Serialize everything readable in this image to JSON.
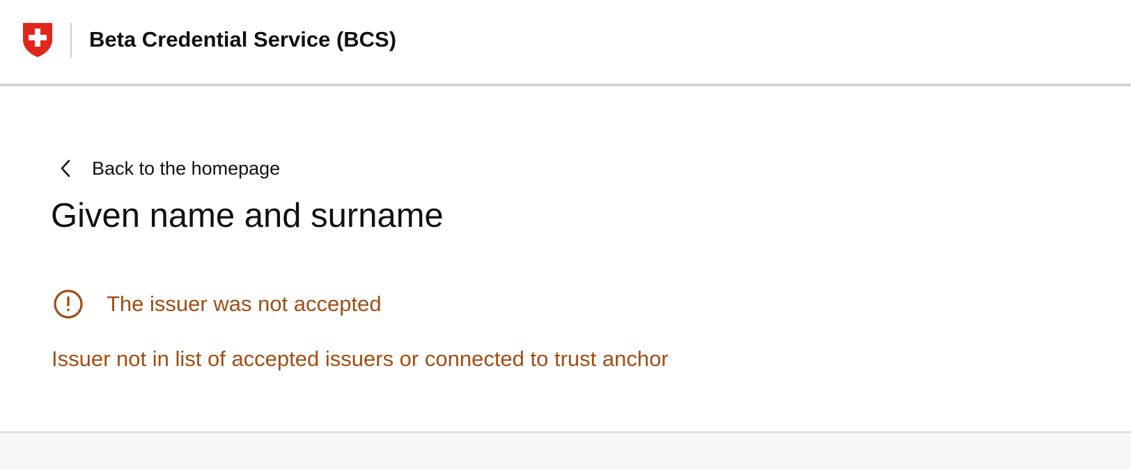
{
  "header": {
    "app_title": "Beta Credential Service (BCS)",
    "logo_icon": "swiss-coat-of-arms-icon"
  },
  "nav": {
    "back_label": "Back to the homepage",
    "back_icon": "chevron-left-icon"
  },
  "main": {
    "page_title": "Given name and surname",
    "alert": {
      "icon": "exclamation-circle-icon",
      "title": "The issuer was not accepted",
      "detail": "Issuer not in list of accepted issuers or connected to trust anchor"
    }
  },
  "colors": {
    "error": "#a14d15",
    "swiss_red": "#e1261c",
    "header_border": "#d4d4d4",
    "footer_bg": "#f7f7f7"
  }
}
